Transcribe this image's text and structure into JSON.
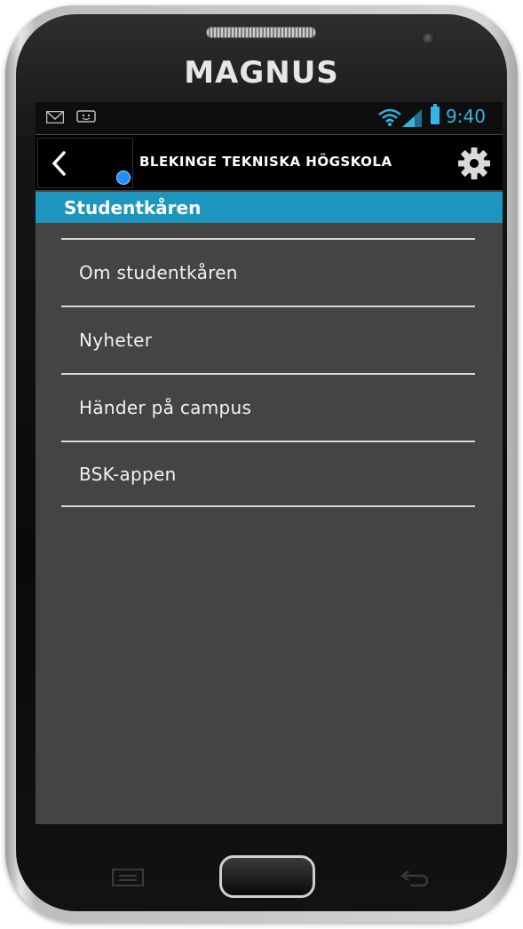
{
  "device": {
    "brand": "MAGNUS",
    "icons": [
      "speaker-grille",
      "front-camera",
      "menu-key-icon",
      "home-button",
      "back-key-icon"
    ]
  },
  "statusbar": {
    "time": "9:40",
    "icons": [
      "gmail-icon",
      "message-icon",
      "wifi-icon",
      "signal-icon",
      "battery-icon"
    ],
    "accent": "#33b5e5"
  },
  "actionbar": {
    "title": "BLEKINGE TEKNISKA HÖGSKOLA",
    "icons": [
      "back-chevron-icon",
      "app-badge-icon",
      "gear-icon"
    ]
  },
  "section": {
    "title": "Studentkåren",
    "color": "#1c95bf"
  },
  "menu": {
    "items": [
      {
        "label": "Om studentkåren"
      },
      {
        "label": "Nyheter"
      },
      {
        "label": "Händer på campus"
      },
      {
        "label": "BSK-appen"
      }
    ]
  },
  "colors": {
    "screen_bg": "#444444",
    "divider": "#d9d9d9"
  }
}
